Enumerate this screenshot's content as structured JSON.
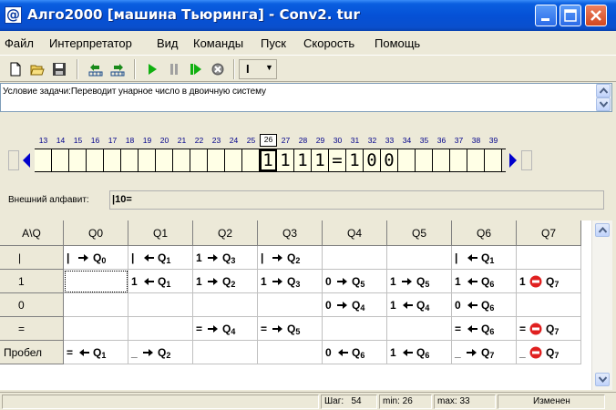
{
  "window": {
    "title": "Алго2000 [машина Тьюринга] - Conv2. tur",
    "app_icon_glyph": "@"
  },
  "menu": [
    "Файл",
    "Интерпретатор",
    "Вид",
    "Команды",
    "Пуск",
    "Скорость",
    "Помощь"
  ],
  "toolbar": {
    "speed_value": "I"
  },
  "task": {
    "label": "Условие задачи:",
    "text": "Переводит унарное число в двоичную систему"
  },
  "tape": {
    "start_index": 13,
    "active_index": 26,
    "indices": [
      "13",
      "14",
      "15",
      "16",
      "17",
      "18",
      "19",
      "20",
      "21",
      "22",
      "23",
      "24",
      "25",
      "26",
      "27",
      "28",
      "29",
      "30",
      "31",
      "32",
      "33",
      "34",
      "35",
      "36",
      "37",
      "38",
      "39"
    ],
    "cells": [
      "",
      "",
      "",
      "",
      "",
      "",
      "",
      "",
      "",
      "",
      "",
      "",
      "",
      "1",
      "1",
      "1",
      "1",
      "=",
      "1",
      "0",
      "0",
      "",
      "",
      "",
      "",
      "",
      ""
    ]
  },
  "alphabet": {
    "label": "Внешний алфавит:",
    "value": "|10="
  },
  "program": {
    "corner": "A\\Q",
    "states": [
      "Q0",
      "Q1",
      "Q2",
      "Q3",
      "Q4",
      "Q5",
      "Q6",
      "Q7"
    ],
    "rows": [
      {
        "symbol": "|",
        "cells": [
          {
            "w": "|",
            "d": "right",
            "q": "0"
          },
          {
            "w": "|",
            "d": "left",
            "q": "1"
          },
          {
            "w": "1",
            "d": "right",
            "q": "3"
          },
          {
            "w": "|",
            "d": "right",
            "q": "2"
          },
          null,
          null,
          {
            "w": "|",
            "d": "left",
            "q": "1"
          },
          null
        ]
      },
      {
        "symbol": "1",
        "cells": [
          null,
          {
            "w": "1",
            "d": "left",
            "q": "1"
          },
          {
            "w": "1",
            "d": "right",
            "q": "2"
          },
          {
            "w": "1",
            "d": "right",
            "q": "3"
          },
          {
            "w": "0",
            "d": "right",
            "q": "5"
          },
          {
            "w": "1",
            "d": "right",
            "q": "5"
          },
          {
            "w": "1",
            "d": "left",
            "q": "6"
          },
          {
            "w": "1",
            "d": "stop",
            "q": "7"
          }
        ]
      },
      {
        "symbol": "0",
        "cells": [
          null,
          null,
          null,
          null,
          {
            "w": "0",
            "d": "right",
            "q": "4"
          },
          {
            "w": "1",
            "d": "left",
            "q": "4"
          },
          {
            "w": "0",
            "d": "left",
            "q": "6"
          },
          null
        ]
      },
      {
        "symbol": "=",
        "cells": [
          null,
          null,
          {
            "w": "=",
            "d": "right",
            "q": "4"
          },
          {
            "w": "=",
            "d": "right",
            "q": "5"
          },
          null,
          null,
          {
            "w": "=",
            "d": "left",
            "q": "6"
          },
          {
            "w": "=",
            "d": "stop",
            "q": "7"
          }
        ]
      },
      {
        "symbol": "Пробел",
        "cells": [
          {
            "w": "=",
            "d": "left",
            "q": "1"
          },
          {
            "w": "_",
            "d": "right",
            "q": "2"
          },
          null,
          null,
          {
            "w": "0",
            "d": "left",
            "q": "6"
          },
          {
            "w": "1",
            "d": "left",
            "q": "6"
          },
          {
            "w": "_",
            "d": "right",
            "q": "7"
          },
          {
            "w": "_",
            "d": "stop",
            "q": "7"
          }
        ]
      }
    ]
  },
  "status": {
    "step_label": "Шаг:",
    "step_value": "54",
    "min_text": "min: 26",
    "max_text": "max: 33",
    "state_text": "Изменен"
  },
  "colors": {
    "titlebar": "#0551d6",
    "tape_cell": "#ffffe6",
    "tape_arrow": "#0000cc",
    "stop_red": "#e02020"
  }
}
